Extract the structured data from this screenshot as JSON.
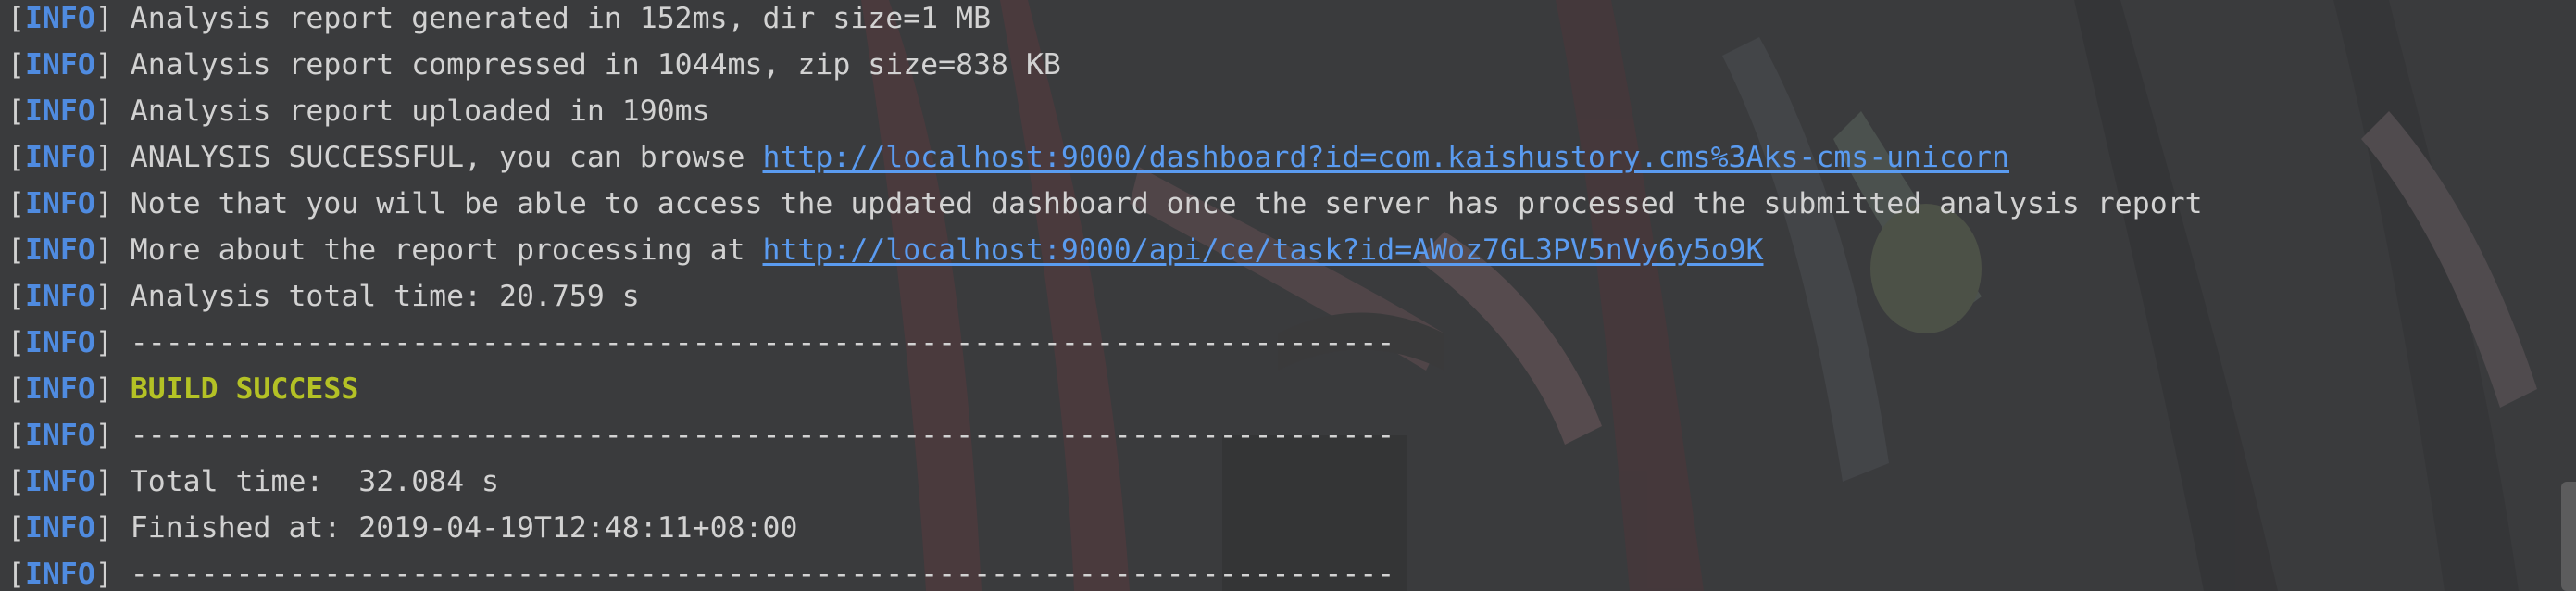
{
  "colors": {
    "background": "#3a3b3d",
    "text": "#d2d2d2",
    "level": "#4f8be0",
    "link": "#5a9bf0",
    "success": "#b4c225"
  },
  "console": {
    "lines": [
      {
        "bracket_open": "[",
        "level": "INFO",
        "bracket_close": "] ",
        "text": "Analysis report generated in 152ms, dir size=1 MB",
        "link": "",
        "success": ""
      },
      {
        "bracket_open": "[",
        "level": "INFO",
        "bracket_close": "] ",
        "text": "Analysis report compressed in 1044ms, zip size=838 KB",
        "link": "",
        "success": ""
      },
      {
        "bracket_open": "[",
        "level": "INFO",
        "bracket_close": "] ",
        "text": "Analysis report uploaded in 190ms",
        "link": "",
        "success": ""
      },
      {
        "bracket_open": "[",
        "level": "INFO",
        "bracket_close": "] ",
        "text": "ANALYSIS SUCCESSFUL, you can browse ",
        "link": "http://localhost:9000/dashboard?id=com.kaishustory.cms%3Aks-cms-unicorn",
        "success": ""
      },
      {
        "bracket_open": "[",
        "level": "INFO",
        "bracket_close": "] ",
        "text": "Note that you will be able to access the updated dashboard once the server has processed the submitted analysis report",
        "link": "",
        "success": ""
      },
      {
        "bracket_open": "[",
        "level": "INFO",
        "bracket_close": "] ",
        "text": "More about the report processing at ",
        "link": "http://localhost:9000/api/ce/task?id=AWoz7GL3PV5nVy6y5o9K",
        "success": ""
      },
      {
        "bracket_open": "[",
        "level": "INFO",
        "bracket_close": "] ",
        "text": "Analysis total time: 20.759 s",
        "link": "",
        "success": ""
      },
      {
        "bracket_open": "[",
        "level": "INFO",
        "bracket_close": "] ",
        "text": "------------------------------------------------------------------------",
        "link": "",
        "success": ""
      },
      {
        "bracket_open": "[",
        "level": "INFO",
        "bracket_close": "] ",
        "text": "",
        "link": "",
        "success": "BUILD SUCCESS"
      },
      {
        "bracket_open": "[",
        "level": "INFO",
        "bracket_close": "] ",
        "text": "------------------------------------------------------------------------",
        "link": "",
        "success": ""
      },
      {
        "bracket_open": "[",
        "level": "INFO",
        "bracket_close": "] ",
        "text": "Total time:  32.084 s",
        "link": "",
        "success": ""
      },
      {
        "bracket_open": "[",
        "level": "INFO",
        "bracket_close": "] ",
        "text": "Finished at: 2019-04-19T12:48:11+08:00",
        "link": "",
        "success": ""
      },
      {
        "bracket_open": "[",
        "level": "INFO",
        "bracket_close": "] ",
        "text": "------------------------------------------------------------------------",
        "link": "",
        "success": ""
      }
    ]
  }
}
